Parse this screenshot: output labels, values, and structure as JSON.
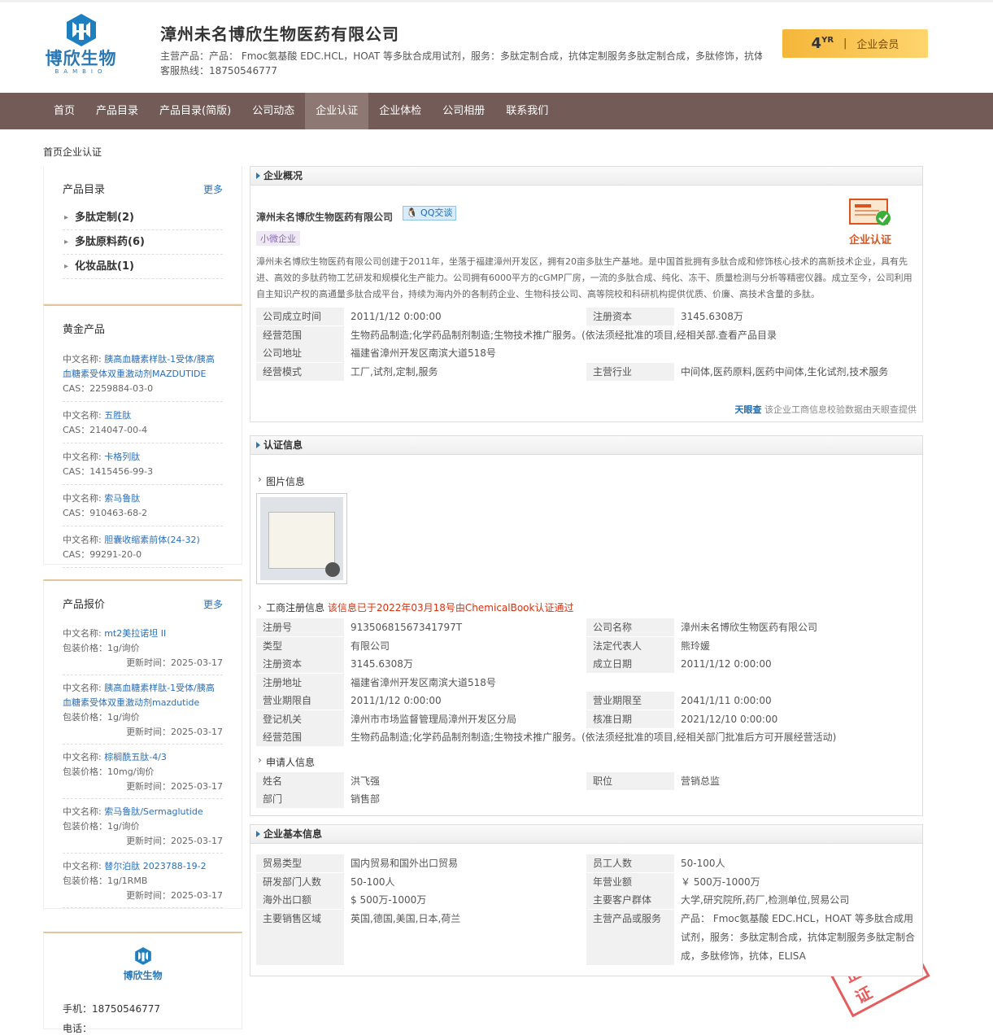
{
  "header": {
    "company": "漳州未名博欣生物医药有限公司",
    "products": "主营产品：产品： Fmoc氨基酸 EDC.HCL，HOAT 等多肽合成用试剂，服务：多肽定制合成，抗体定制服务多肽定制合成，多肽修饰，抗体...",
    "tel": "客服热线：18750546777",
    "logo_cn": "博欣生物",
    "logo_en": "BAMBIO",
    "member_years": "4",
    "member_yr": "YR",
    "member_label": "企业会员"
  },
  "nav": [
    "首页",
    "产品目录",
    "产品目录(简版)",
    "公司动态",
    "企业认证",
    "企业体检",
    "公司相册",
    "联系我们"
  ],
  "breadcrumb": "首页企业认证",
  "sidebar": {
    "catalog": {
      "title": "产品目录",
      "more": "更多",
      "items": [
        "多肽定制(2)",
        "多肽原料药(6)",
        "化妆品肽(1)"
      ]
    },
    "gold": {
      "title": "黄金产品",
      "items": [
        {
          "label": "中文名称:",
          "name": "胰高血糖素样肽-1受体/胰高血糖素受体双重激动剂MAZDUTIDE",
          "cas": "CAS：2259884-03-0"
        },
        {
          "label": "中文名称:",
          "name": "五胜肽",
          "cas": "CAS：214047-00-4"
        },
        {
          "label": "中文名称:",
          "name": "卡格列肽",
          "cas": "CAS：1415456-99-3"
        },
        {
          "label": "中文名称:",
          "name": "索马鲁肽",
          "cas": "CAS：910463-68-2"
        },
        {
          "label": "中文名称:",
          "name": "胆囊收缩素前体(24-32)",
          "cas": "CAS：99291-20-0"
        }
      ]
    },
    "quotes": {
      "title": "产品报价",
      "more": "更多",
      "items": [
        {
          "label": "中文名称:",
          "name": "mt2美拉诺坦 II",
          "pack": "包装价格：1g/询价",
          "time": "更新时间：2025-03-17"
        },
        {
          "label": "中文名称:",
          "name": "胰高血糖素样肽-1受体/胰高血糖素受体双重激动剂mazdutide",
          "pack": "包装价格：1g/询价",
          "time": "更新时间：2025-03-17"
        },
        {
          "label": "中文名称:",
          "name": "棕榈酰五肽-4/3",
          "pack": "包装价格：10mg/询价",
          "time": "更新时间：2025-03-17"
        },
        {
          "label": "中文名称:",
          "name": "索马鲁肽/Sermaglutide",
          "pack": "包装价格：1g/询价",
          "time": "更新时间：2025-03-17"
        },
        {
          "label": "中文名称:",
          "name": "替尔泊肽 2023788-19-2",
          "pack": "包装价格：1g/1RMB",
          "time": "更新时间：2025-03-17"
        }
      ]
    },
    "contact": {
      "mobile": "手机：18750546777",
      "phone": "电话："
    }
  },
  "overview": {
    "title": "企业概况",
    "company": "漳州未名博欣生物医药有限公司",
    "qq": "QQ交谈",
    "tag": "小微企业",
    "cert": "企业认证",
    "desc": "漳州未名博欣生物医药有限公司创建于2011年，坐落于福建漳州开发区，拥有20亩多肽生产基地。是中国首批拥有多肽合成和修饰核心技术的高新技术企业，具有先进、高效的多肽药物工艺研发和规模化生产能力。公司拥有6000平方的cGMP厂房，一流的多肽合成、纯化、冻干、质量检测与分析等精密仪器。成立至今，公司利用自主知识产权的高通量多肽合成平台，持续为海内外的各制药企业、生物科技公司、高等院校和科研机构提供优质、价廉、高技术含量的多肽。",
    "rows": [
      {
        "k1": "公司成立时间",
        "v1": "2011/1/12 0:00:00",
        "k2": "注册资本",
        "v2": "3145.6308万"
      },
      {
        "k1": "经营范围",
        "v1": "生物药品制造;化学药品制剂制造;生物技术推广服务。(依法须经批准的项目,经相关部...",
        "link": "查看产品目录"
      },
      {
        "k1": "公司地址",
        "v1": "福建省漳州开发区南滨大道518号"
      },
      {
        "k1": "经营模式",
        "v1": "工厂,试剂,定制,服务",
        "k2": "主营行业",
        "v2": "中间体,医药原料,医药中间体,生化试剂,技术服务"
      }
    ],
    "tianyan": "天眼查",
    "tianyan_note": "该企业工商信息校验数据由天眼查提供"
  },
  "certinfo": {
    "title": "认证信息",
    "pic_title": "图片信息",
    "license_title": "工商注册信息",
    "license_note": "该信息已于2022年03月18号由ChemicalBook认证通过",
    "stamp": "企业认证",
    "rows": [
      {
        "k1": "注册号",
        "v1": "91350681567341797T",
        "k2": "公司名称",
        "v2": "漳州未名博欣生物医药有限公司"
      },
      {
        "k1": "类型",
        "v1": "有限公司",
        "k2": "法定代表人",
        "v2": "熊玲媛"
      },
      {
        "k1": "注册资本",
        "v1": "3145.6308万",
        "k2": "成立日期",
        "v2": "2011/1/12 0:00:00"
      },
      {
        "k1": "注册地址",
        "v1": "福建省漳州开发区南滨大道518号"
      },
      {
        "k1": "营业期限自",
        "v1": "2011/1/12 0:00:00",
        "k2": "营业期限至",
        "v2": "2041/1/11 0:00:00"
      },
      {
        "k1": "登记机关",
        "v1": "漳州市市场监督管理局漳州开发区分局",
        "k2": "核准日期",
        "v2": "2021/12/10 0:00:00"
      },
      {
        "k1": "经营范围",
        "v1": "生物药品制造;化学药品制剂制造;生物技术推广服务。(依法须经批准的项目,经相关部门批准后方可开展经营活动)"
      }
    ],
    "applicant_title": "申请人信息",
    "applicant": [
      {
        "k1": "姓名",
        "v1": "洪飞强",
        "k2": "职位",
        "v2": "营销总监"
      },
      {
        "k1": "部门",
        "v1": "销售部"
      }
    ]
  },
  "basic": {
    "title": "企业基本信息",
    "rows": [
      {
        "k1": "贸易类型",
        "v1": "国内贸易和国外出口贸易",
        "k2": "员工人数",
        "v2": "50-100人"
      },
      {
        "k1": "研发部门人数",
        "v1": "50-100人",
        "k2": "年营业额",
        "v2": "￥ 500万-1000万"
      },
      {
        "k1": "海外出口额",
        "v1": "$ 500万-1000万",
        "k2": "主要客户群体",
        "v2": "大学,研究院所,药厂,检测单位,贸易公司"
      },
      {
        "k1": "主要销售区域",
        "v1": "英国,德国,美国,日本,荷兰",
        "k2": "主营产品或服务",
        "v2": "产品： Fmoc氨基酸 EDC.HCL，HOAT 等多肽合成用试剂，服务：多肽定制合成，抗体定制服务多肽定制合成，多肽修饰，抗体，ELISA"
      }
    ]
  },
  "colors": {
    "nav": "#735c58",
    "accent": "#2a79b6",
    "link": "#2a6fba",
    "red": "#d9310e",
    "gold": "#f4b63a"
  }
}
